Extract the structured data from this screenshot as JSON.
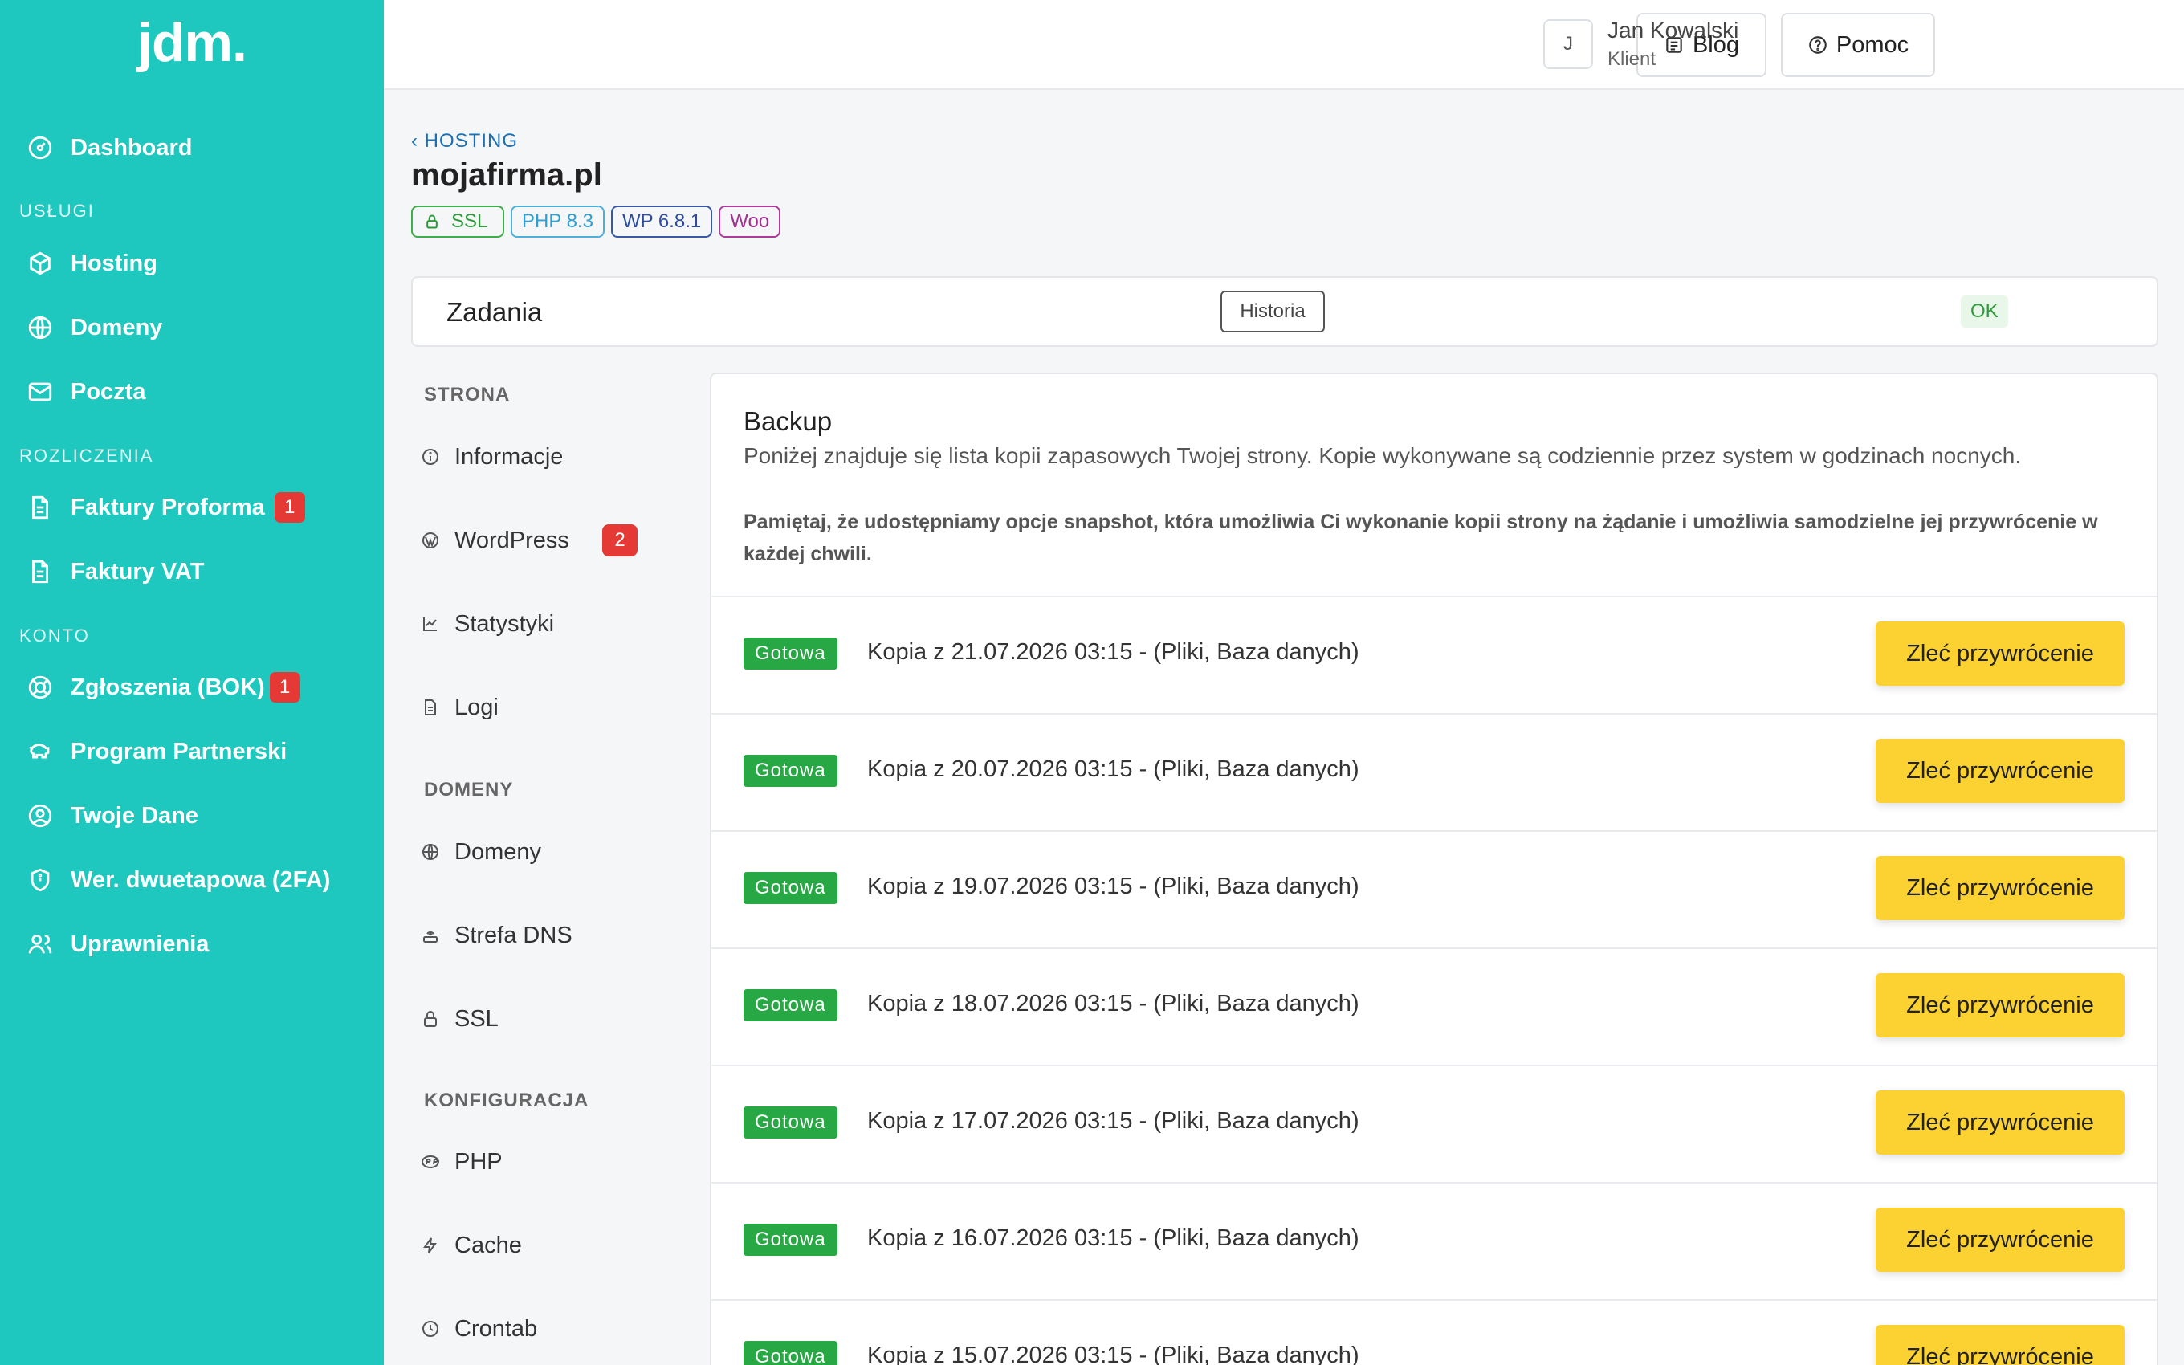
{
  "app": {
    "logo": "jdm."
  },
  "sidebar": {
    "items": [
      {
        "label": "Dashboard"
      },
      {
        "label": "Hosting"
      },
      {
        "label": "Domeny"
      },
      {
        "label": "Poczta"
      },
      {
        "label": "Faktury Proforma",
        "badge": "1"
      },
      {
        "label": "Faktury VAT"
      },
      {
        "label": "Zgłoszenia (BOK)",
        "badge": "1"
      },
      {
        "label": "Program Partnerski"
      },
      {
        "label": "Twoje Dane"
      },
      {
        "label": "Wer. dwuetapowa (2FA)"
      },
      {
        "label": "Uprawnienia"
      }
    ],
    "sections": {
      "uslugi": "USŁUGI",
      "rozliczenia": "ROZLICZENIA",
      "konto": "KONTO"
    }
  },
  "topbar": {
    "blog_label": "Blog",
    "help_label": "Pomoc",
    "user": {
      "initial": "J",
      "name": "Jan Kowalski",
      "role": "Klient"
    }
  },
  "header": {
    "breadcrumb": "‹ HOSTING",
    "title": "mojafirma.pl",
    "tags": {
      "ssl": "SSL",
      "php": "PHP 8.3",
      "wp": "WP 6.8.1",
      "woo": "Woo"
    }
  },
  "tasks": {
    "title": "Zadania",
    "status": "OK",
    "history_label": "Historia"
  },
  "subnav": {
    "sections": {
      "strona": "STRONA",
      "domeny": "DOMENY",
      "konfiguracja": "KONFIGURACJA"
    },
    "items": [
      {
        "label": "Informacje"
      },
      {
        "label": "WordPress",
        "badge": "2"
      },
      {
        "label": "Statystyki"
      },
      {
        "label": "Logi"
      },
      {
        "label": "Domeny"
      },
      {
        "label": "Strefa DNS"
      },
      {
        "label": "SSL"
      },
      {
        "label": "PHP"
      },
      {
        "label": "Cache"
      },
      {
        "label": "Crontab"
      }
    ]
  },
  "backup": {
    "title": "Backup",
    "description": "Poniżej znajduje się lista kopii zapasowych Twojej strony. Kopie wykonywane są codziennie przez system w godzinach nocnych.",
    "note": "Pamiętaj, że udostępniamy opcje snapshot, która umożliwia Ci wykonanie kopii strony na żądanie i umożliwia samodzielne jej przywrócenie w każdej chwili.",
    "restore_label": "Zleć przywrócenie",
    "rows": [
      {
        "status": "Gotowa",
        "text": "Kopia z 21.07.2026 03:15 - (Pliki, Baza danych)"
      },
      {
        "status": "Gotowa",
        "text": "Kopia z 20.07.2026 03:15 - (Pliki, Baza danych)"
      },
      {
        "status": "Gotowa",
        "text": "Kopia z 19.07.2026 03:15 - (Pliki, Baza danych)"
      },
      {
        "status": "Gotowa",
        "text": "Kopia z 18.07.2026 03:15 - (Pliki, Baza danych)"
      },
      {
        "status": "Gotowa",
        "text": "Kopia z 17.07.2026 03:15 - (Pliki, Baza danych)"
      },
      {
        "status": "Gotowa",
        "text": "Kopia z 16.07.2026 03:15 - (Pliki, Baza danych)"
      },
      {
        "status": "Gotowa",
        "text": "Kopia z 15.07.2026 03:15 - (Pliki, Baza danych)"
      }
    ]
  }
}
